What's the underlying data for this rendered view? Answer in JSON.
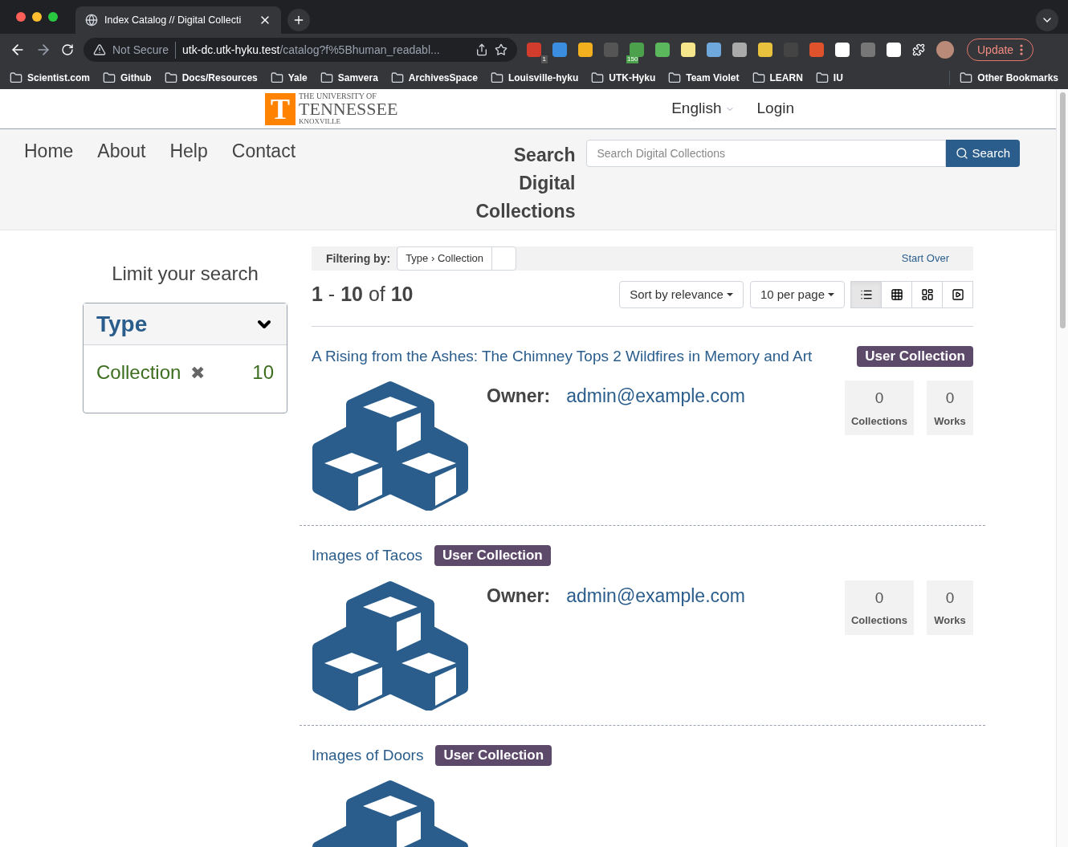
{
  "browser": {
    "tab": {
      "title": "Index Catalog // Digital Collecti"
    },
    "address": {
      "security": "Not Secure",
      "host": "utk-dc.utk-hyku.test",
      "path": "/catalog?f%5Bhuman_readabl..."
    },
    "extension_badges": [
      "1",
      "150"
    ],
    "update": "Update",
    "bookmarks": [
      "Scientist.com",
      "Github",
      "Docs/Resources",
      "Yale",
      "Samvera",
      "ArchivesSpace",
      "Louisville-hyku",
      "UTK-Hyku",
      "Team Violet",
      "LEARN",
      "IU"
    ],
    "other_bookmarks": "Other Bookmarks"
  },
  "header": {
    "logo": {
      "line1": "THE UNIVERSITY OF",
      "line2": "TENNESSEE",
      "line3": "KNOXVILLE",
      "letter": "T"
    },
    "language": "English",
    "login": "Login"
  },
  "nav": {
    "items": [
      "Home",
      "About",
      "Help",
      "Contact"
    ],
    "search_label": "Search Digital Collections",
    "search_placeholder": "Search Digital Collections",
    "search_button": "Search"
  },
  "sidebar": {
    "title": "Limit your search",
    "facet": {
      "name": "Type",
      "expanded": true,
      "values": [
        {
          "label": "Collection",
          "count": "10",
          "remove": "✖"
        }
      ]
    }
  },
  "constraints": {
    "label": "Filtering by:",
    "filter_field": "Type",
    "filter_separator": "›",
    "filter_value": "Collection",
    "start_over": "Start Over"
  },
  "results": {
    "count": "**1** - **10** of **10**",
    "sort": "Sort by relevance",
    "per_page": "10 per page",
    "views": [
      {
        "kind": "list",
        "selected": true
      },
      {
        "kind": "gallery",
        "selected": false
      },
      {
        "kind": "masonry",
        "selected": false
      },
      {
        "kind": "slideshow",
        "selected": false
      }
    ],
    "items": [
      {
        "title": "A Rising from the Ashes: The Chimney Tops 2 Wildfires in Memory and Art",
        "badge": "User Collection",
        "owner_label": "Owner:",
        "owner": "admin@example.com",
        "stats": [
          {
            "value": "0",
            "label": "Collections"
          },
          {
            "value": "0",
            "label": "Works"
          }
        ]
      },
      {
        "title": "Images of Tacos",
        "badge": "User Collection",
        "owner_label": "Owner:",
        "owner": "admin@example.com",
        "stats": [
          {
            "value": "0",
            "label": "Collections"
          },
          {
            "value": "0",
            "label": "Works"
          }
        ]
      },
      {
        "title": "Images of Doors",
        "badge": "User Collection"
      }
    ]
  }
}
